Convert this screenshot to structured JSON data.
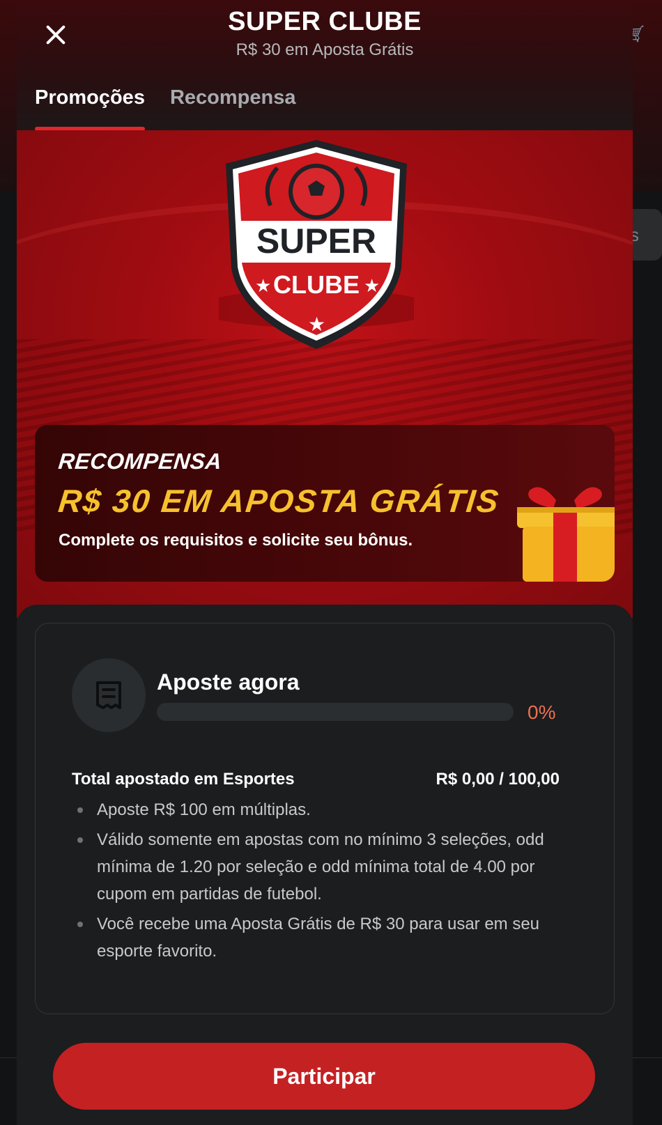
{
  "modal": {
    "title": "SUPER CLUBE",
    "subtitle": "R$ 30 em Aposta Grátis"
  },
  "tabs": [
    {
      "label": "Promoções",
      "active": true
    },
    {
      "label": "Recompensa",
      "active": false
    }
  ],
  "banner": {
    "badge_top_text": "SUPER",
    "badge_bottom_text": "CLUBE"
  },
  "reward": {
    "label": "RECOMPENSA",
    "amount": "R$ 30 EM APOSTA GRÁTIS",
    "description": "Complete os requisitos e solicite seu bônus."
  },
  "requirement": {
    "title": "Aposte agora",
    "progress_text": "0%",
    "progress_value": 0,
    "stat_label": "Total apostado em Esportes",
    "stat_value": "R$ 0,00 / 100,00",
    "bullets": [
      "Aposte R$ 100 em múltiplas.",
      "Válido somente em apostas com no mínimo 3 seleções, odd mínima de 1.20 por seleção e odd mínima total de 4.00 por cupom em partidas de futebol.",
      "Você recebe uma Aposta Grátis de R$ 30 para usar em seu esporte favorito."
    ]
  },
  "cta": {
    "label": "Participar"
  },
  "colors": {
    "accent": "#e3262a",
    "button": "#c42123",
    "gold": "#f6c12e",
    "progress_text": "#f06f4f"
  },
  "icons": {
    "close": "close-icon",
    "receipt": "receipt-icon",
    "gift": "gift-icon",
    "background_right": "cart-icon"
  }
}
